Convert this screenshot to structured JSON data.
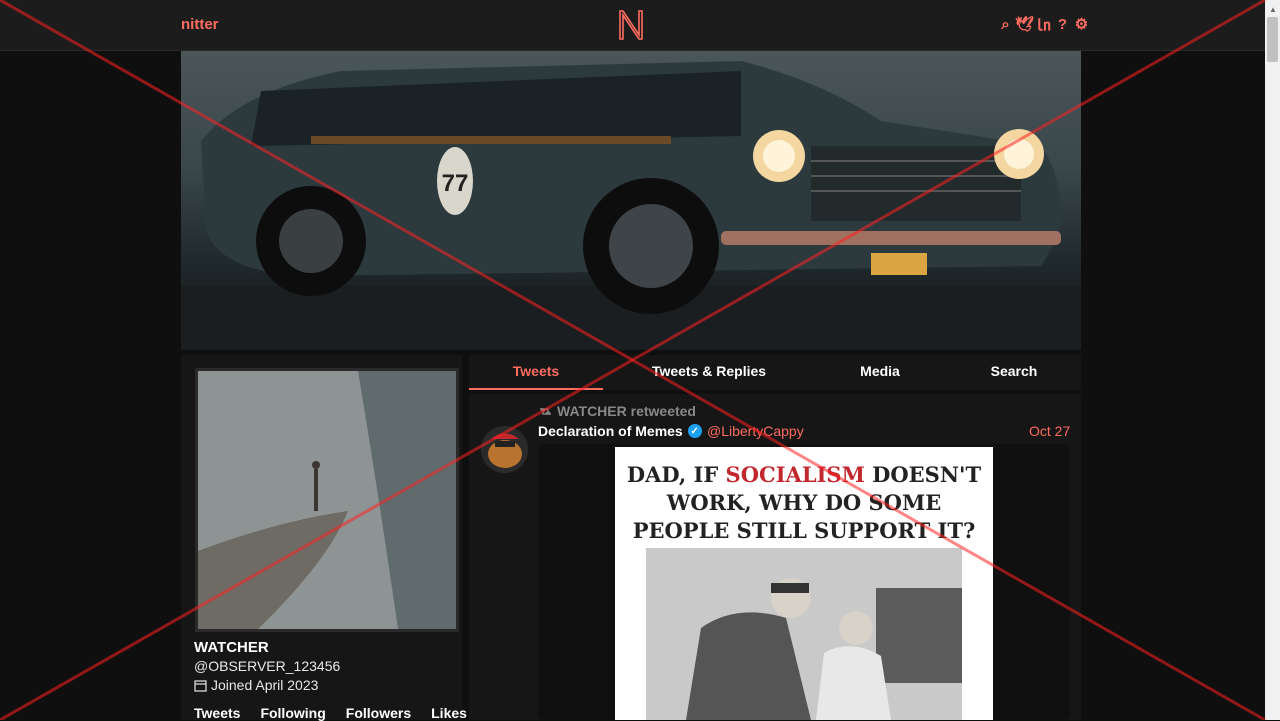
{
  "nav": {
    "brand": "nitter",
    "logo_letter": "N",
    "icons": [
      "search-icon",
      "twitter-bird-icon",
      "rss-icon",
      "help-icon",
      "gear-icon"
    ],
    "icon_glyphs": [
      "⌕",
      "🕊",
      "㏑",
      "?",
      "⚙"
    ]
  },
  "profile": {
    "name": "WATCHER",
    "handle": "@OBSERVER_123456",
    "joined": "Joined April 2023",
    "stats": [
      "Tweets",
      "Following",
      "Followers",
      "Likes"
    ]
  },
  "tabs": [
    "Tweets",
    "Tweets & Replies",
    "Media",
    "Search"
  ],
  "active_tab": "Tweets",
  "tweet": {
    "retweet_label": "WATCHER retweeted",
    "author": "Declaration of Memes",
    "handle": "@LibertyCappy",
    "date": "Oct 27",
    "meme_line1_pre": "DAD, IF",
    "meme_line1_red": "SOCIALISM",
    "meme_line1_post": "DOESN'T",
    "meme_line2": "WORK, WHY DO SOME",
    "meme_line3": "PEOPLE STILL SUPPORT IT?"
  },
  "colors": {
    "accent": "#ff6c60",
    "background": "#0f0f0f",
    "panel": "#161616",
    "navbar": "#1c1c1c",
    "verified": "#1da1f2",
    "overlay_cross": "#ff2020"
  }
}
